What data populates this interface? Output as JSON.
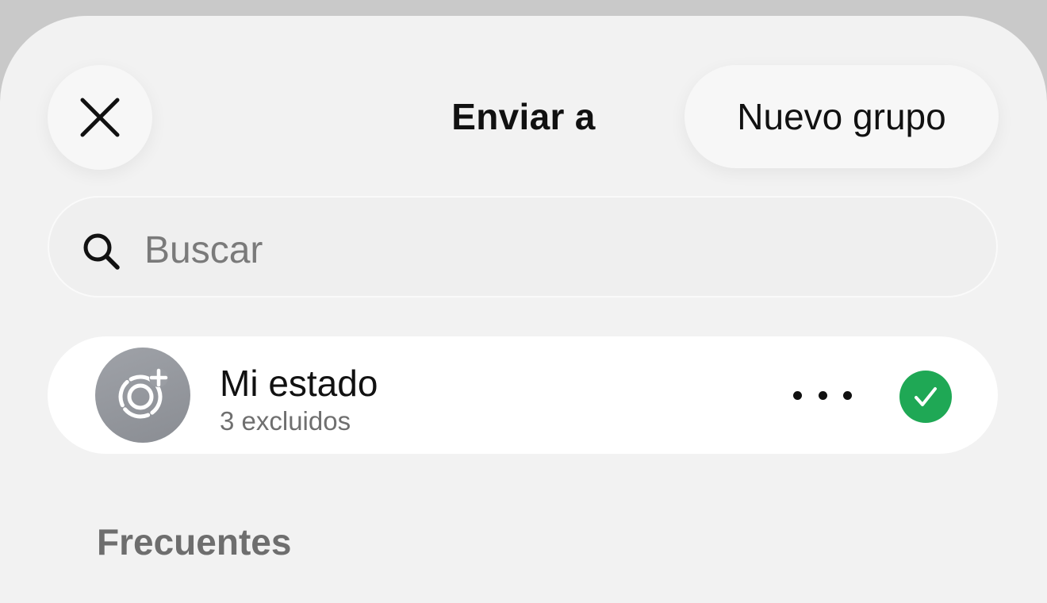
{
  "header": {
    "close_icon": "close-icon",
    "title": "Enviar a",
    "new_group_label": "Nuevo grupo"
  },
  "search": {
    "icon": "search-icon",
    "placeholder": "Buscar",
    "value": ""
  },
  "my_status": {
    "avatar_icon": "status-add-icon",
    "name": "Mi estado",
    "subtitle": "3 excluidos",
    "more_icon": "ellipsis-icon",
    "selected": true,
    "check_icon": "check-icon",
    "accent_color": "#1fa855"
  },
  "sections": {
    "frequent_label": "Frecuentes"
  }
}
